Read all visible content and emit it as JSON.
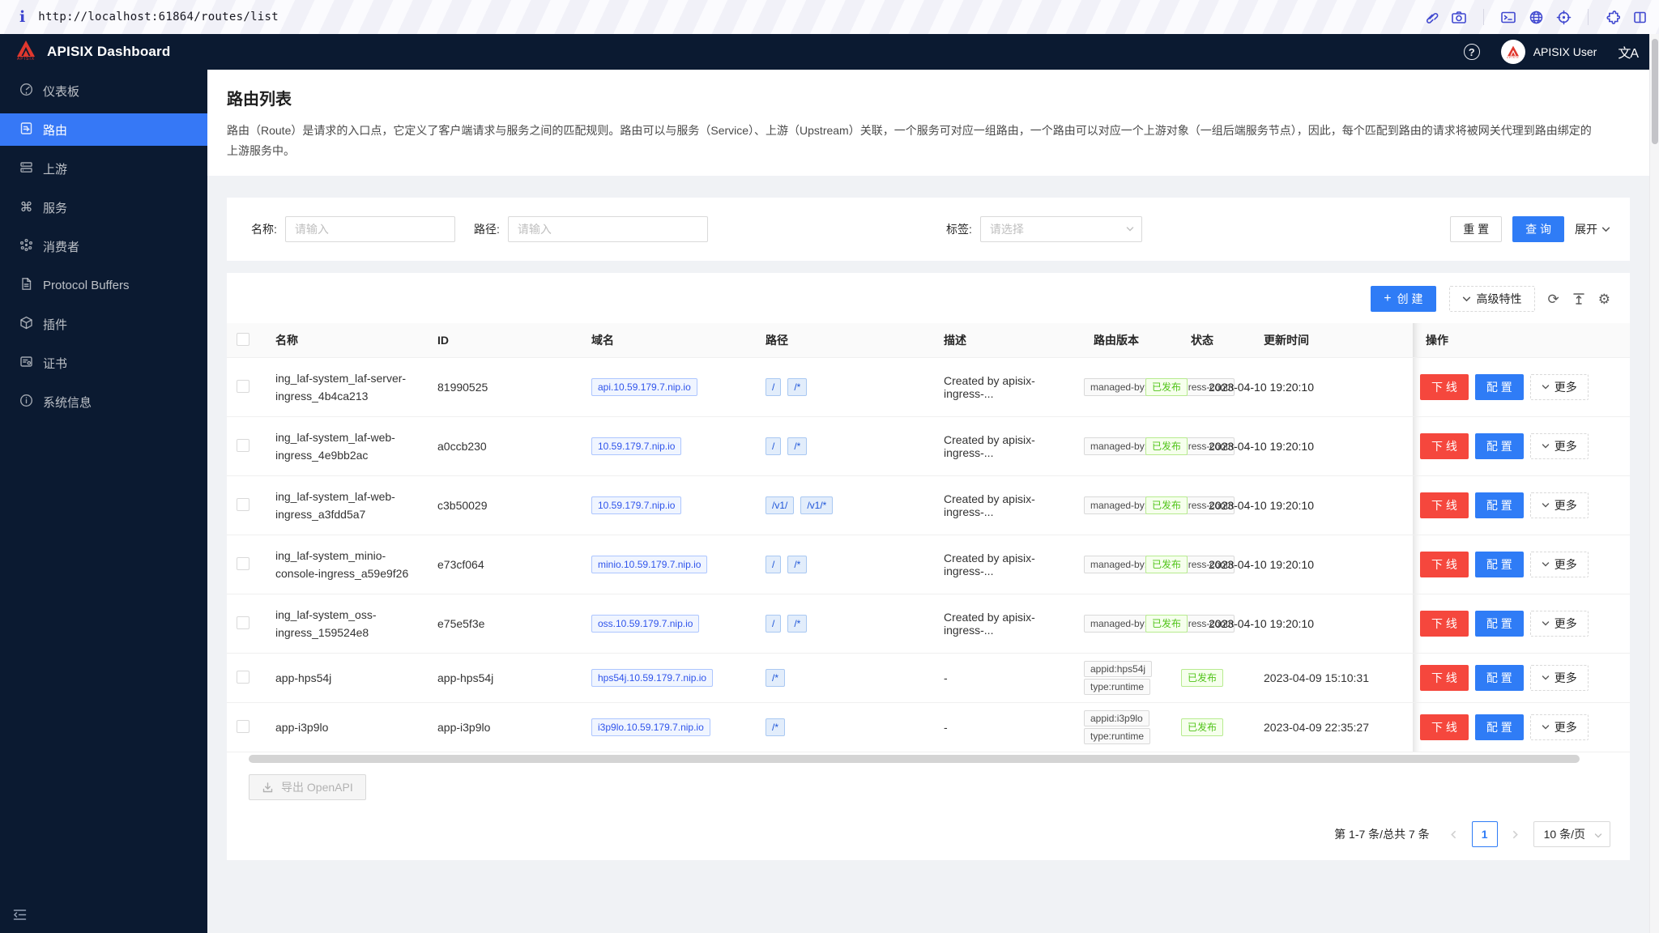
{
  "browser": {
    "info_glyph": "i",
    "url": "http://localhost:61864/routes/list",
    "icon_names": [
      "link-icon",
      "camera-icon",
      "terminal-icon",
      "globe-icon",
      "crosshair-icon",
      "puzzle-icon",
      "split-columns-icon"
    ]
  },
  "header": {
    "title": "APISIX Dashboard",
    "logo_word": "APISIX",
    "help_glyph": "?",
    "user_name": "APISIX User",
    "translate_glyph": "文A"
  },
  "sidebar": {
    "items": [
      {
        "label": "仪表板",
        "icon": "dashboard-icon",
        "active": false
      },
      {
        "label": "路由",
        "icon": "routes-icon",
        "active": true
      },
      {
        "label": "上游",
        "icon": "upstream-icon",
        "active": false
      },
      {
        "label": "服务",
        "icon": "service-icon",
        "active": false
      },
      {
        "label": "消费者",
        "icon": "consumer-icon",
        "active": false
      },
      {
        "label": "Protocol Buffers",
        "icon": "file-icon",
        "active": false
      },
      {
        "label": "插件",
        "icon": "plugin-icon",
        "active": false
      },
      {
        "label": "证书",
        "icon": "certificate-icon",
        "active": false
      },
      {
        "label": "系统信息",
        "icon": "info-circle-icon",
        "active": false
      }
    ],
    "service_glyph": "⌘"
  },
  "page": {
    "title": "路由列表",
    "description": "路由（Route）是请求的入口点，它定义了客户端请求与服务之间的匹配规则。路由可以与服务（Service）、上游（Upstream）关联，一个服务可对应一组路由，一个路由可以对应一个上游对象（一组后端服务节点），因此，每个匹配到路由的请求将被网关代理到路由绑定的上游服务中。"
  },
  "search": {
    "name_label": "名称:",
    "path_label": "路径:",
    "tag_label": "标签:",
    "name_placeholder": "请输入",
    "path_placeholder": "请输入",
    "tag_placeholder": "请选择",
    "reset_label": "重 置",
    "query_label": "查 询",
    "expand_label": "展开"
  },
  "toolbar": {
    "create_plus": "+",
    "create_label": "创 建",
    "advanced_label": "高级特性",
    "refresh_glyph": "⟳",
    "gear_glyph": "⚙"
  },
  "table": {
    "headers": {
      "name": "名称",
      "id": "ID",
      "domain": "域名",
      "path": "路径",
      "description": "描述",
      "version": "路由版本",
      "status": "状态",
      "updated": "更新时间",
      "actions": "操作"
    },
    "action_labels": {
      "offline": "下 线",
      "configure": "配 置",
      "more": "更多"
    },
    "rows": [
      {
        "name": "ing_laf-system_laf-server-ingress_4b4ca213",
        "id": "81990525",
        "domain": "api.10.59.179.7.nip.io",
        "path1": "/",
        "path2": "/*",
        "description": "Created by apisix-ingress-...",
        "version_tag": "managed-by:apisix-ingress-controller",
        "status": "已发布",
        "updated": "2023-04-10 19:20:10"
      },
      {
        "name": "ing_laf-system_laf-web-ingress_4e9bb2ac",
        "id": "a0ccb230",
        "domain": "10.59.179.7.nip.io",
        "path1": "/",
        "path2": "/*",
        "description": "Created by apisix-ingress-...",
        "version_tag": "managed-by:apisix-ingress-controller",
        "status": "已发布",
        "updated": "2023-04-10 19:20:10"
      },
      {
        "name": "ing_laf-system_laf-web-ingress_a3fdd5a7",
        "id": "c3b50029",
        "domain": "10.59.179.7.nip.io",
        "path1": "/v1/",
        "path2": "/v1/*",
        "description": "Created by apisix-ingress-...",
        "version_tag": "managed-by:apisix-ingress-controller",
        "status": "已发布",
        "updated": "2023-04-10 19:20:10"
      },
      {
        "name": "ing_laf-system_minio-console-ingress_a59e9f26",
        "id": "e73cf064",
        "domain": "minio.10.59.179.7.nip.io",
        "path1": "/",
        "path2": "/*",
        "description": "Created by apisix-ingress-...",
        "version_tag": "managed-by:apisix-ingress-controller",
        "status": "已发布",
        "updated": "2023-04-10 19:20:10"
      },
      {
        "name": "ing_laf-system_oss-ingress_159524e8",
        "id": "e75e5f3e",
        "domain": "oss.10.59.179.7.nip.io",
        "path1": "/",
        "path2": "/*",
        "description": "Created by apisix-ingress-...",
        "version_tag": "managed-by:apisix-ingress-controller",
        "status": "已发布",
        "updated": "2023-04-10 19:20:10"
      },
      {
        "name": "app-hps54j",
        "id": "app-hps54j",
        "domain": "hps54j.10.59.179.7.nip.io",
        "path1": "/*",
        "description": "-",
        "version_tag1": "appid:hps54j",
        "version_tag2": "type:runtime",
        "status": "已发布",
        "updated": "2023-04-09 15:10:31"
      },
      {
        "name": "app-i3p9lo",
        "id": "app-i3p9lo",
        "domain": "i3p9lo.10.59.179.7.nip.io",
        "path1": "/*",
        "description": "-",
        "version_tag1": "appid:i3p9lo",
        "version_tag2": "type:runtime",
        "status": "已发布",
        "updated": "2023-04-09 22:35:27"
      }
    ]
  },
  "footer": {
    "export_label": "导出 OpenAPI",
    "pagination_total": "第 1-7 条/总共 7 条",
    "current_page": "1",
    "page_size": "10 条/页"
  },
  "colors": {
    "primary_blue": "#2f7cf6",
    "menu_active_blue": "#3678f6",
    "danger_red": "#f5473d",
    "header_navy": "#0b1a31",
    "published_green_text": "#52c41a",
    "published_green_bg": "#f6ffed",
    "page_background": "#f0f2f5"
  }
}
